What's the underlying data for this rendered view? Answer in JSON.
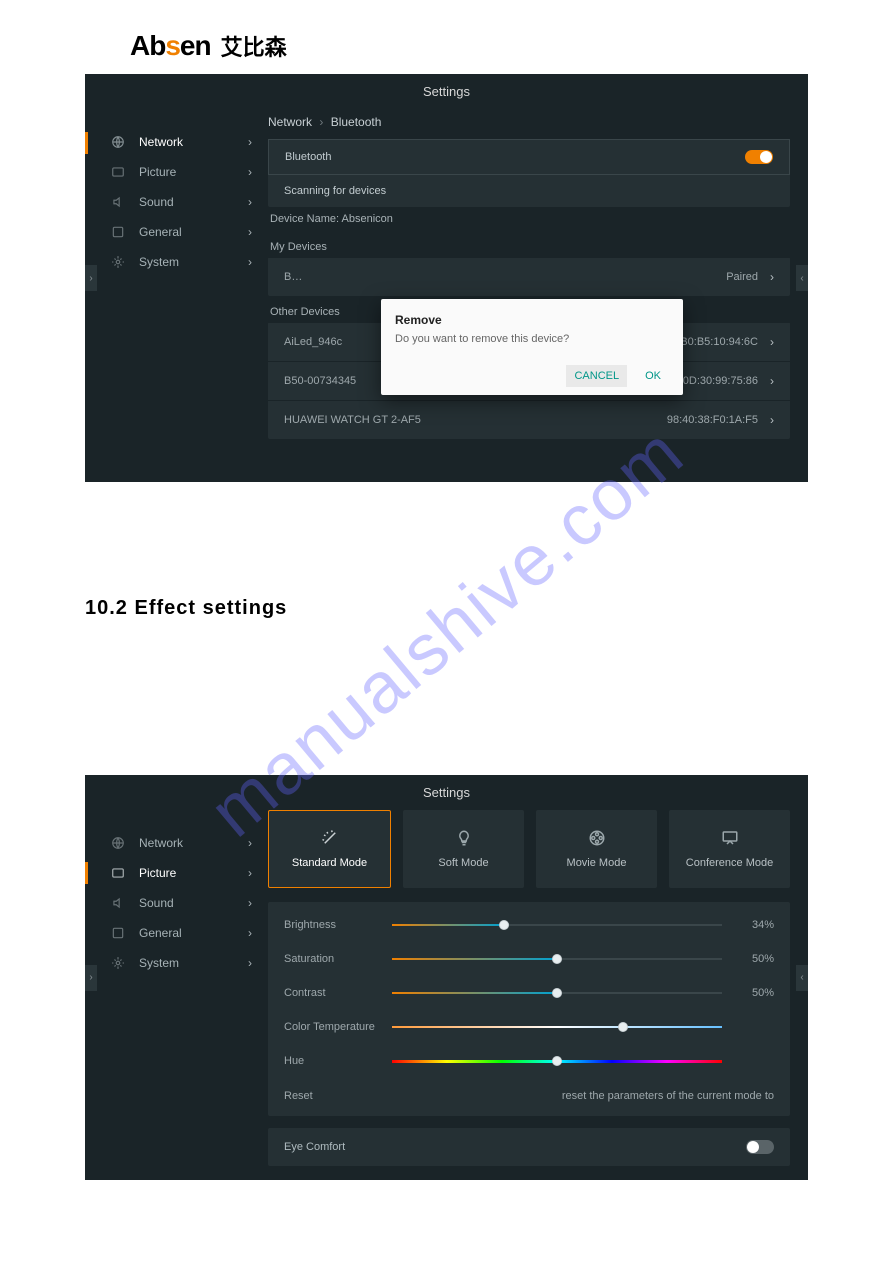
{
  "logo": {
    "brand": "Absen",
    "cn": "艾比森"
  },
  "watermark": "manualshive.com",
  "section_heading": "10.2 Effect settings",
  "screenshot1": {
    "title": "Settings",
    "sidebar": {
      "items": [
        {
          "label": "Network"
        },
        {
          "label": "Picture"
        },
        {
          "label": "Sound"
        },
        {
          "label": "General"
        },
        {
          "label": "System"
        }
      ]
    },
    "breadcrumb": {
      "a": "Network",
      "b": "Bluetooth"
    },
    "bluetooth_label": "Bluetooth",
    "scanning_label": "Scanning for devices",
    "device_name_label": "Device Name:",
    "device_name_value": "Absenicon",
    "my_devices_label": "My Devices",
    "my_device_row": {
      "name": "B…",
      "status": "Paired"
    },
    "other_devices_label": "Other Devices",
    "other_devices": [
      {
        "name": "AiLed_946c",
        "mac": "F2:B0:B5:10:94:6C"
      },
      {
        "name": "B50-00734345",
        "mac": "DC:0D:30:99:75:86"
      },
      {
        "name": "HUAWEI WATCH GT 2-AF5",
        "mac": "98:40:38:F0:1A:F5"
      }
    ],
    "dialog": {
      "title": "Remove",
      "message": "Do you want to remove this device?",
      "cancel": "CANCEL",
      "ok": "OK"
    }
  },
  "screenshot2": {
    "title": "Settings",
    "sidebar": {
      "items": [
        {
          "label": "Network"
        },
        {
          "label": "Picture"
        },
        {
          "label": "Sound"
        },
        {
          "label": "General"
        },
        {
          "label": "System"
        }
      ]
    },
    "modes": [
      {
        "label": "Standard Mode"
      },
      {
        "label": "Soft Mode"
      },
      {
        "label": "Movie Mode"
      },
      {
        "label": "Conference Mode"
      }
    ],
    "sliders": {
      "brightness": {
        "label": "Brightness",
        "value": "34%",
        "pct": 34
      },
      "saturation": {
        "label": "Saturation",
        "value": "50%",
        "pct": 50
      },
      "contrast": {
        "label": "Contrast",
        "value": "50%",
        "pct": 50
      },
      "color_temp": {
        "label": "Color Temperature",
        "pct": 70
      },
      "hue": {
        "label": "Hue",
        "pct": 50
      }
    },
    "reset": {
      "label": "Reset",
      "hint": "reset the parameters of the current mode to"
    },
    "eye_comfort": "Eye Comfort"
  }
}
